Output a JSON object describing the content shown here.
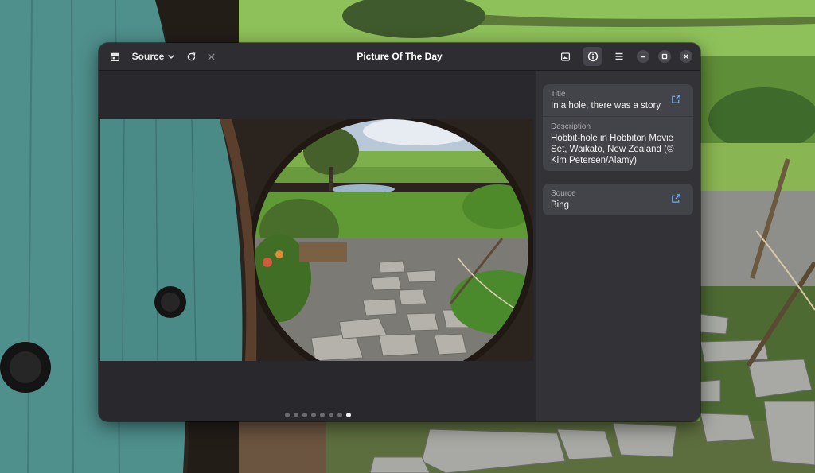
{
  "window": {
    "title": "Picture Of The Day",
    "source_button_label": "Source"
  },
  "icons": {
    "calendar": "calendar-icon",
    "chevron": "chevron-down-icon",
    "refresh": "refresh-icon",
    "cancel": "close-icon",
    "set_wallpaper": "set-wallpaper-icon",
    "info": "info-icon",
    "menu": "hamburger-menu-icon",
    "minimize": "minimize-icon",
    "maximize": "maximize-icon",
    "close": "window-close-icon",
    "open_link": "external-link-icon"
  },
  "info_panel": {
    "details_card": [
      {
        "label": "Title",
        "value": "In a hole, there was a story"
      },
      {
        "label": "Description",
        "value": "Hobbit-hole in Hobbiton Movie Set, Waikato, New Zealand (© Kim Petersen/Alamy)"
      }
    ],
    "source_card": [
      {
        "label": "Source",
        "value": "Bing"
      }
    ]
  },
  "pager": {
    "total": 8,
    "current": 8
  },
  "colors": {
    "window_bg": "#242428",
    "headerbar_bg": "#2e2e32",
    "sidebar_bg": "#333337",
    "card_bg": "#43434a",
    "link_accent": "#78aeed"
  }
}
